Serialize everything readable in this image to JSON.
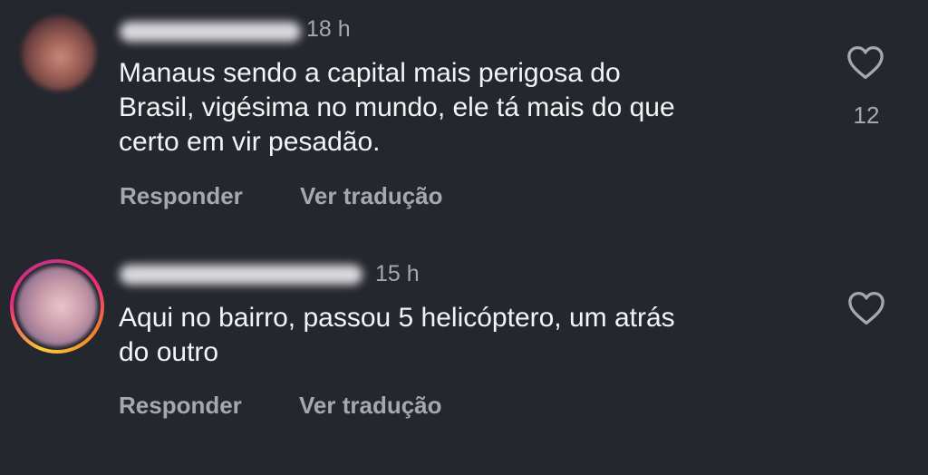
{
  "comments": [
    {
      "time": "18 h",
      "text": "Manaus sendo a capital mais perigosa do\nBrasil, vigésima no mundo, ele tá mais do que\ncerto em vir pesadão.",
      "reply_label": "Responder",
      "translate_label": "Ver tradução",
      "like_count": "12",
      "like_icon": "heart-outline-icon",
      "username_state": "blurred"
    },
    {
      "time": "15 h",
      "text": "Aqui no bairro, passou 5 helicóptero, um atrás\ndo outro",
      "reply_label": "Responder",
      "translate_label": "Ver tradução",
      "like_icon": "heart-outline-icon",
      "username_state": "blurred",
      "avatar_ring": "story-gradient"
    }
  ],
  "colors": {
    "background": "#25272e",
    "primary_text": "#f3f4f6",
    "secondary_text": "#a5a8b1",
    "story_ring": [
      "#f9ce34",
      "#ee2a7b",
      "#c13584",
      "#f58529"
    ]
  }
}
